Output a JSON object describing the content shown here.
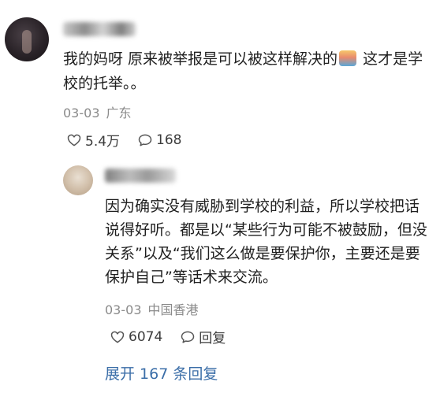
{
  "comment": {
    "author_avatar": "user-avatar",
    "text_part1": "我的妈呀 原来被举报是可以被这样解决的",
    "emoji": "smiling-face-emoji",
    "text_part2": " 这才是学校的托举。。",
    "date": "03-03",
    "location": "广东",
    "likes": "5.4万",
    "replies": "168"
  },
  "reply": {
    "author_avatar": "user-avatar",
    "text": "因为确实没有威胁到学校的利益，所以学校把话说得好听。都是以“某些行为可能不被鼓励，但没关系”以及“我们这么做是要保护你，主要还是要保护自己”等话术来交流。",
    "date": "03-03",
    "location": "中国香港",
    "likes": "6074",
    "reply_label": "回复"
  },
  "expand_replies": "展开 167 条回复",
  "colors": {
    "link": "#3b6ea8",
    "meta": "#8a8a8a",
    "text": "#1f1f1f"
  }
}
